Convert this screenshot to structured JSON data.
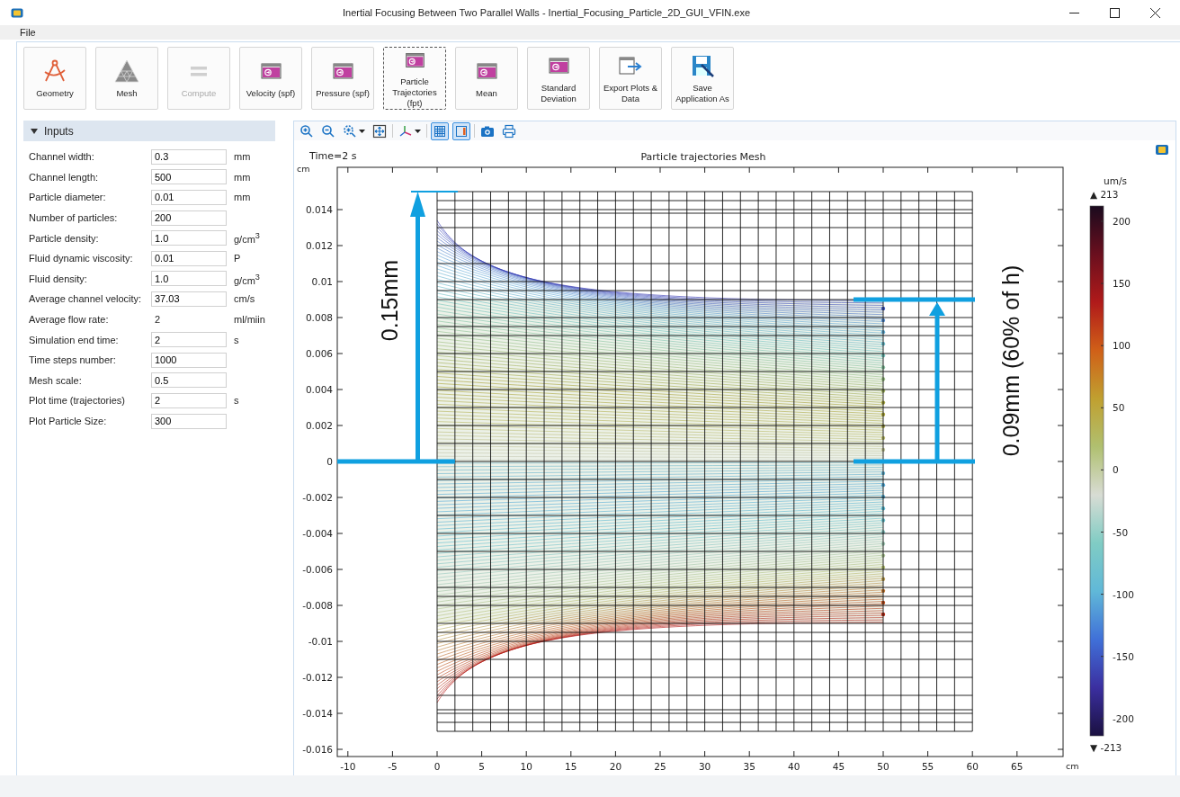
{
  "window": {
    "title": "Inertial Focusing Between Two Parallel Walls - Inertial_Focusing_Particle_2D_GUI_VFIN.exe"
  },
  "menu": [
    "File"
  ],
  "ribbon": [
    {
      "label": "Geometry",
      "kind": "geometry",
      "disabled": false,
      "focused": false
    },
    {
      "label": "Mesh",
      "kind": "mesh",
      "disabled": false,
      "focused": false
    },
    {
      "label": "Compute",
      "kind": "compute",
      "disabled": true,
      "focused": false
    },
    {
      "label": "Velocity (spf)",
      "kind": "plot",
      "disabled": false,
      "focused": false
    },
    {
      "label": "Pressure (spf)",
      "kind": "plot",
      "disabled": false,
      "focused": false
    },
    {
      "label": "Particle Trajectories (fpt)",
      "kind": "plot",
      "disabled": false,
      "focused": true
    },
    {
      "label": "Mean",
      "kind": "plot",
      "disabled": false,
      "focused": false
    },
    {
      "label": "Standard Deviation",
      "kind": "plot",
      "disabled": false,
      "focused": false
    },
    {
      "label": "Export Plots & Data",
      "kind": "export",
      "disabled": false,
      "focused": false
    },
    {
      "label": "Save Application As",
      "kind": "save",
      "disabled": false,
      "focused": false
    }
  ],
  "inputs": {
    "title": "Inputs",
    "expanded": true,
    "rows": [
      {
        "label": "Channel width:",
        "kind": "field",
        "value": "0.3",
        "unit": "mm"
      },
      {
        "label": "Channel length:",
        "kind": "field",
        "value": "500",
        "unit": "mm"
      },
      {
        "label": "Particle diameter:",
        "kind": "field",
        "value": "0.01",
        "unit": "mm"
      },
      {
        "label": "Number of particles:",
        "kind": "field",
        "value": "200"
      },
      {
        "label": "Particle density:",
        "kind": "field",
        "value": "1.0",
        "unit": "g/cm$^{3}$"
      },
      {
        "label": "Fluid dynamic viscosity:",
        "kind": "field",
        "value": "0.01",
        "unit": "P"
      },
      {
        "label": "Fluid density:",
        "kind": "field",
        "value": "1.0",
        "unit": "g/cm$^{3}$"
      },
      {
        "label": "Average channel velocity:",
        "kind": "field",
        "value": "37.03",
        "unit": "cm/s"
      },
      {
        "label": "Average flow rate:",
        "kind": "text",
        "value": "2",
        "unit": "ml/miin"
      },
      {
        "label": "Simulation end time:",
        "kind": "field",
        "value": "2",
        "unit": "s"
      },
      {
        "label": "Time steps number:",
        "kind": "field",
        "value": "1000"
      },
      {
        "label": "Mesh scale:",
        "kind": "field",
        "value": "0.5"
      },
      {
        "label": "Plot time (trajectories)",
        "kind": "field",
        "value": "2",
        "unit": "s"
      },
      {
        "label": "Plot Particle Size:",
        "kind": "field",
        "value": "300"
      }
    ]
  },
  "plot_toolbar": [
    {
      "kind": "zoom-in",
      "on": false
    },
    {
      "kind": "zoom-out",
      "on": false
    },
    {
      "kind": "zoom-box",
      "on": false
    },
    {
      "kind": "zoom-extents",
      "on": false
    },
    {
      "kind": "axis",
      "on": false
    },
    {
      "kind": "grid",
      "on": true
    },
    {
      "kind": "legend",
      "on": true
    },
    {
      "kind": "camera",
      "on": false
    },
    {
      "kind": "print",
      "on": false
    }
  ],
  "plot": {
    "time_label": "Time=2 s",
    "title": "Particle trajectories Mesh",
    "y_unit": "cm",
    "x_unit": "cm",
    "x_ticks": [
      "-10",
      "-5",
      "0",
      "5",
      "10",
      "15",
      "20",
      "25",
      "30",
      "35",
      "40",
      "45",
      "50",
      "55",
      "60",
      "65"
    ],
    "y_ticks": [
      "0.014",
      "0.012",
      "0.01",
      "0.008",
      "0.006",
      "0.004",
      "0.002",
      "0",
      "-0.002",
      "-0.004",
      "-0.006",
      "-0.008",
      "-0.01",
      "-0.012",
      "-0.014",
      "-0.016"
    ],
    "annotations": [
      "0.15mm",
      "0.09mm (60% of h)"
    ],
    "colorbar": {
      "unit": "um/s",
      "max": "▲ 213",
      "min": "▼ -213",
      "ticks": [
        "200",
        "150",
        "100",
        "50",
        "0",
        "-50",
        "-100",
        "-150",
        "-200"
      ]
    }
  }
}
